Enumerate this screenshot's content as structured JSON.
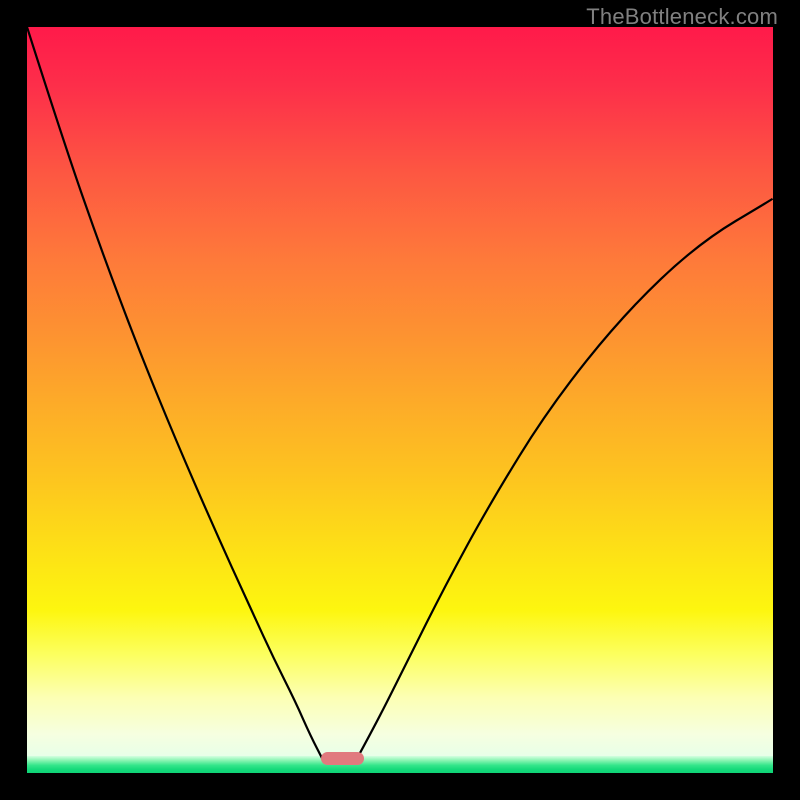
{
  "watermark": "TheBottleneck.com",
  "chart_data": {
    "type": "line",
    "title": "",
    "xlabel": "",
    "ylabel": "",
    "xlim": [
      0,
      1
    ],
    "ylim": [
      0,
      1
    ],
    "series": [
      {
        "name": "left-branch",
        "x": [
          0.0,
          0.05,
          0.1,
          0.15,
          0.2,
          0.25,
          0.3,
          0.33,
          0.36,
          0.38,
          0.398
        ],
        "y": [
          1.0,
          0.843,
          0.7,
          0.567,
          0.445,
          0.33,
          0.22,
          0.155,
          0.095,
          0.05,
          0.015
        ]
      },
      {
        "name": "right-branch",
        "x": [
          0.44,
          0.47,
          0.51,
          0.56,
          0.62,
          0.7,
          0.8,
          0.9,
          1.0
        ],
        "y": [
          0.015,
          0.07,
          0.15,
          0.25,
          0.36,
          0.49,
          0.615,
          0.71,
          0.77
        ]
      }
    ],
    "marker": {
      "x_start": 0.394,
      "x_end": 0.452,
      "color": "#e17a7e"
    },
    "gradient_colors": {
      "top": "#ff1a4a",
      "mid": "#fdc51f",
      "pale": "#fcffb4",
      "green": "#14d97a"
    }
  }
}
